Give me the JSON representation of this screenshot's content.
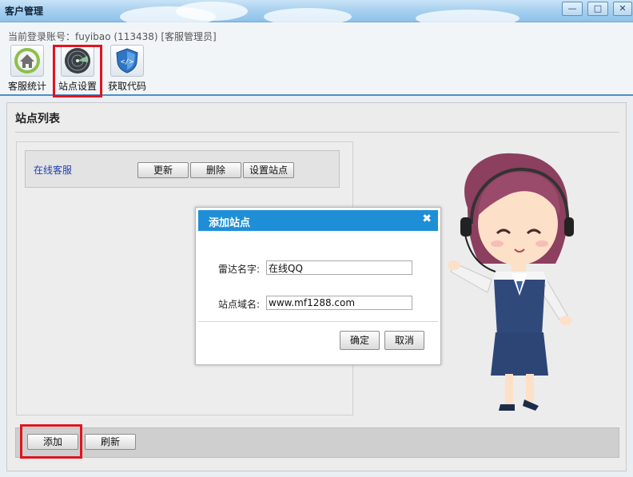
{
  "window": {
    "title": "客户管理",
    "controls": {
      "minimize": "—",
      "maximize": "□",
      "close": "✕"
    }
  },
  "header": {
    "login_info": "当前登录账号：fuyibao (113438) [客服管理员]",
    "toolbar": [
      {
        "label": "客服统计",
        "icon": "home-icon"
      },
      {
        "label": "站点设置",
        "icon": "radar-icon",
        "highlighted": true
      },
      {
        "label": "获取代码",
        "icon": "code-shield-icon"
      }
    ]
  },
  "main": {
    "section_title": "站点列表",
    "sites": [
      {
        "name": "在线客服",
        "buttons": [
          "更新",
          "删除",
          "设置站点"
        ]
      }
    ],
    "bottom_buttons": {
      "add": "添加",
      "refresh": "刷新"
    }
  },
  "dialog": {
    "title": "添加站点",
    "close": "✖",
    "fields": [
      {
        "label": "雷达名字:",
        "value": "在线QQ"
      },
      {
        "label": "站点域名:",
        "value": "www.mf1288.com"
      }
    ],
    "buttons": {
      "ok": "确定",
      "cancel": "取消"
    }
  },
  "colors": {
    "highlight_border": "#e0141e",
    "dialog_header": "#1e8fd6",
    "link": "#1f3fb0"
  }
}
